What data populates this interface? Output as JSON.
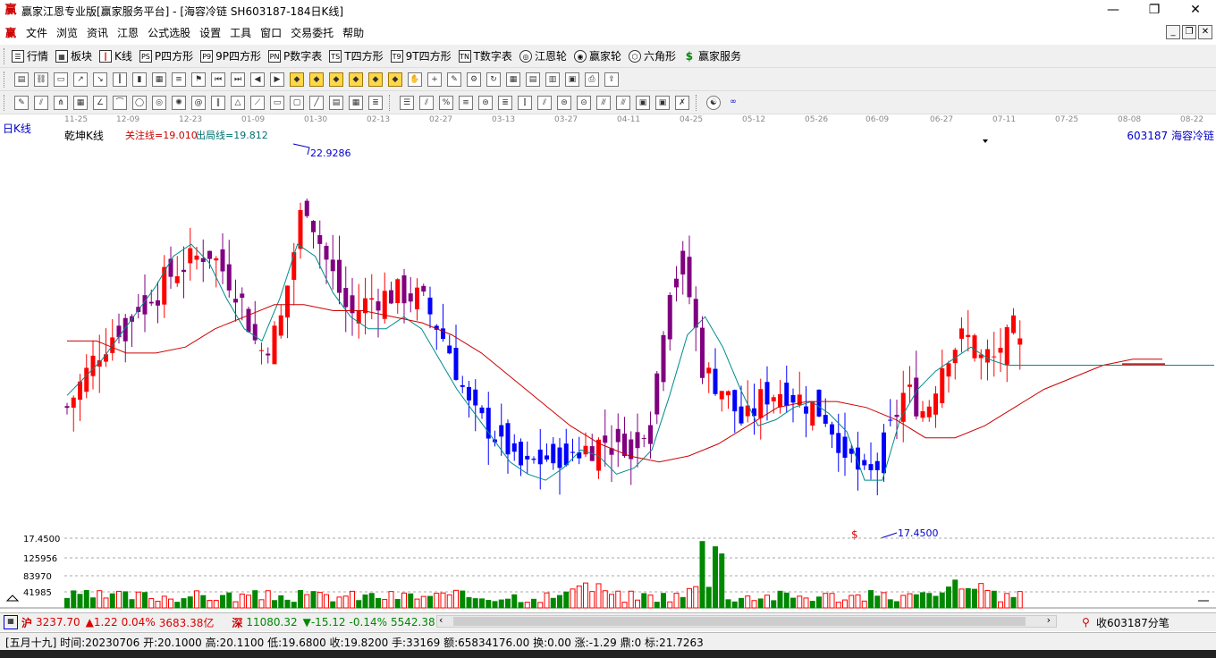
{
  "window": {
    "title": "赢家江恩专业版[赢家服务平台] - [海容冷链  SH603187-184日K线]",
    "minimize": "—",
    "maximize": "❐",
    "close": "✕"
  },
  "menu": [
    "文件",
    "浏览",
    "资讯",
    "江恩",
    "公式选股",
    "设置",
    "工具",
    "窗口",
    "交易委托",
    "帮助"
  ],
  "toolbar1": [
    {
      "icon": "list-icon",
      "label": "行情"
    },
    {
      "icon": "blocks-icon",
      "label": "板块"
    },
    {
      "icon": "kline-icon",
      "label": "K线"
    },
    {
      "icon": "ps-icon",
      "label": "P四方形"
    },
    {
      "icon": "p9-icon",
      "label": "9P四方形"
    },
    {
      "icon": "pn-icon",
      "label": "P数字表"
    },
    {
      "icon": "ts-icon",
      "label": "T四方形"
    },
    {
      "icon": "t9-icon",
      "label": "9T四方形"
    },
    {
      "icon": "tn-icon",
      "label": "T数字表"
    },
    {
      "icon": "wheel-icon",
      "label": "江恩轮"
    },
    {
      "icon": "winner-wheel-icon",
      "label": "赢家轮"
    },
    {
      "icon": "hexagon-icon",
      "label": "六角形"
    },
    {
      "icon": "dollar-icon",
      "label": "赢家服务"
    }
  ],
  "chart": {
    "period": "日K线",
    "title": "乾坤K线",
    "guanzhu": "关注线=19.010",
    "chuju": "出局线=19.812",
    "code": "603187  海容冷链",
    "high_label": "22.9286",
    "low_label": "17.4500",
    "dollar_mark": "$",
    "dates": [
      "11-25",
      "12-09",
      "12-23",
      "01-09",
      "01-30",
      "02-13",
      "02-27",
      "03-13",
      "03-27",
      "04-11",
      "04-25",
      "05-12",
      "05-26",
      "06-09",
      "06-27",
      "07-11",
      "07-25",
      "08-08",
      "08-22"
    ],
    "vol_axis": [
      "17.4500",
      "125956",
      "83970",
      "41985"
    ]
  },
  "status": {
    "sh_index": "3237.70",
    "sh_change": "▲1.22",
    "sh_pct": "0.04%",
    "sh_amount": "3683.38亿",
    "sz_index": "11080.32",
    "sz_change": "▼-15.12",
    "sz_pct": "-0.14%",
    "sz_amount": "5542.38",
    "right_label": "收603187分笔"
  },
  "bottom": {
    "info": "[五月十九] 时间:20230706 开:20.1000 高:20.1100 低:19.6800 收:19.8200 手:33169 额:65834176.00 换:0.00 涨:-1.29 鼎:0 标:21.7263"
  },
  "chart_data": {
    "type": "candlestick",
    "ylim": [
      17.0,
      23.5
    ],
    "ma_short": [
      19.3,
      19.6,
      19.9,
      20.3,
      20.7,
      21.1,
      21.6,
      21.8,
      21.5,
      20.9,
      20.4,
      20.2,
      20.9,
      21.8,
      21.6,
      21.0,
      20.6,
      20.4,
      20.4,
      20.6,
      20.4,
      19.9,
      19.4,
      19.0,
      18.6,
      18.2,
      18.0,
      17.9,
      18.1,
      18.4,
      18.3,
      18.0,
      18.1,
      18.4,
      19.3,
      20.3,
      20.6,
      20.1,
      19.4,
      18.8,
      18.9,
      19.1,
      19.2,
      19.0,
      18.7,
      17.9,
      17.9,
      18.9,
      19.4,
      19.7,
      19.9,
      20.1,
      19.9,
      19.8,
      19.8,
      19.8,
      19.8
    ],
    "ma_long": [
      20.2,
      20.2,
      20.0,
      20.0,
      20.1,
      20.4,
      20.6,
      20.8,
      20.8,
      20.7,
      20.7,
      20.6,
      20.5,
      20.3,
      20.0,
      19.6,
      19.2,
      18.8,
      18.5,
      18.3,
      18.2,
      18.3,
      18.5,
      18.8,
      19.1,
      19.2,
      19.2,
      19.1,
      18.9,
      18.6,
      18.6,
      18.8,
      19.1,
      19.4,
      19.6,
      19.8,
      19.9,
      19.9
    ]
  }
}
